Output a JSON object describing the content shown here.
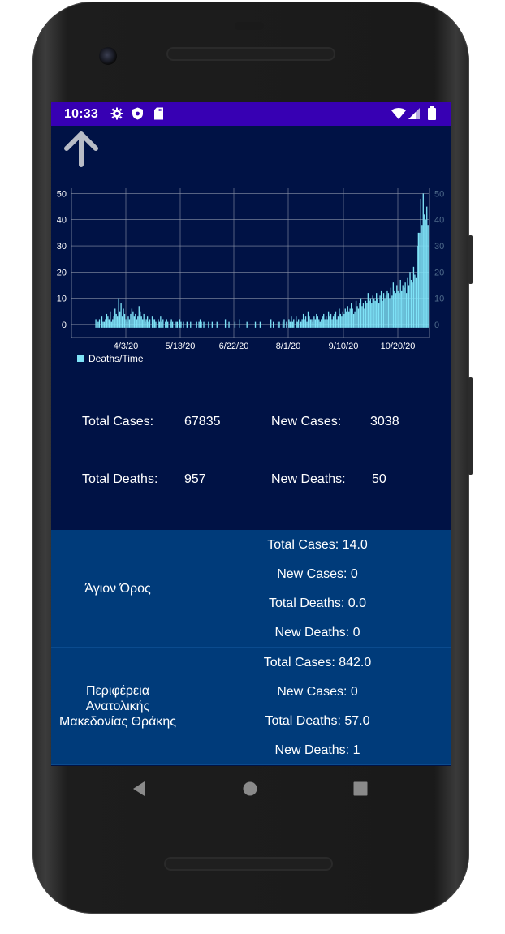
{
  "status_bar": {
    "time": "10:33"
  },
  "chart_data": {
    "type": "bar",
    "x_tick_labels": [
      "4/3/20",
      "5/13/20",
      "6/22/20",
      "8/1/20",
      "9/10/20",
      "10/20/20"
    ],
    "y_ticks": [
      0,
      10,
      20,
      30,
      40,
      50
    ],
    "ylim": [
      -5,
      52
    ],
    "legend": "Deaths/Time",
    "legend_position": "bottom-left",
    "bar_color": "#7fe3f7",
    "grid": true,
    "values": [
      0,
      0,
      0,
      2,
      1,
      1,
      2,
      0,
      3,
      1,
      1,
      2,
      4,
      3,
      2,
      5,
      1,
      2,
      3,
      6,
      4,
      3,
      10,
      5,
      8,
      3,
      6,
      4,
      2,
      1,
      3,
      2,
      4,
      6,
      5,
      3,
      4,
      2,
      3,
      7,
      5,
      3,
      2,
      4,
      1,
      2,
      3,
      1,
      2,
      0,
      3,
      2,
      2,
      1,
      0,
      2,
      1,
      3,
      1,
      2,
      0,
      1,
      2,
      1,
      0,
      1,
      2,
      1,
      0,
      0,
      1,
      1,
      0,
      2,
      1,
      0,
      1,
      0,
      0,
      1,
      0,
      0,
      1,
      0,
      0,
      0,
      0,
      1,
      0,
      1,
      2,
      1,
      0,
      1,
      0,
      0,
      0,
      1,
      0,
      0,
      1,
      0,
      0,
      0,
      1,
      0,
      0,
      0,
      0,
      0,
      0,
      2,
      0,
      0,
      1,
      0,
      0,
      0,
      0,
      1,
      0,
      0,
      0,
      2,
      0,
      0,
      0,
      0,
      0,
      1,
      0,
      0,
      0,
      0,
      0,
      0,
      1,
      0,
      0,
      0,
      1,
      0,
      0,
      0,
      0,
      0,
      0,
      0,
      0,
      2,
      0,
      1,
      0,
      0,
      0,
      1,
      1,
      0,
      0,
      1,
      2,
      0,
      1,
      0,
      2,
      1,
      3,
      1,
      2,
      0,
      3,
      1,
      2,
      0,
      1,
      2,
      4,
      2,
      3,
      1,
      5,
      3,
      2,
      2,
      1,
      3,
      2,
      4,
      3,
      2,
      1,
      2,
      3,
      4,
      2,
      3,
      2,
      5,
      3,
      4,
      2,
      3,
      4,
      5,
      2,
      3,
      6,
      4,
      3,
      5,
      4,
      6,
      5,
      7,
      5,
      6,
      8,
      6,
      4,
      5,
      9,
      7,
      6,
      8,
      10,
      7,
      8,
      6,
      9,
      8,
      12,
      9,
      10,
      8,
      11,
      10,
      9,
      12,
      10,
      8,
      11,
      13,
      9,
      12,
      10,
      11,
      13,
      12,
      10,
      14,
      11,
      16,
      13,
      12,
      15,
      13,
      12,
      17,
      13,
      15,
      14,
      16,
      12,
      18,
      15,
      20,
      17,
      16,
      22,
      19,
      18,
      30,
      35,
      35,
      48,
      38,
      50,
      42,
      40,
      45,
      38
    ]
  },
  "summary": {
    "total_cases_label": "Total Cases:",
    "total_cases_value": "67835",
    "new_cases_label": "New Cases:",
    "new_cases_value": "3038",
    "total_deaths_label": "Total Deaths:",
    "total_deaths_value": "957",
    "new_deaths_label": "New Deaths:",
    "new_deaths_value": "50"
  },
  "regions": [
    {
      "name": "Άγιον Όρος",
      "total_cases": "Total Cases: 14.0",
      "new_cases": "New Cases: 0",
      "total_deaths": "Total Deaths: 0.0",
      "new_deaths": "New Deaths: 0"
    },
    {
      "name_lines": [
        "Περιφέρεια",
        "Ανατολικής",
        "Μακεδονίας Θράκης"
      ],
      "total_cases": "Total Cases: 842.0",
      "new_cases": "New Cases: 0",
      "total_deaths": "Total Deaths: 57.0",
      "new_deaths": "New Deaths: 1"
    }
  ],
  "icons": {
    "status": [
      "gear-icon",
      "shield-icon",
      "sd-card-icon",
      "wifi-icon",
      "signal-icon",
      "battery-icon"
    ],
    "toolbar": [
      "arrow-up-icon"
    ],
    "nav": [
      "back-icon",
      "home-icon",
      "recents-icon"
    ]
  },
  "colors": {
    "status_bar": "#3700b3",
    "background": "#001245",
    "region_background": "#003b7a",
    "bar": "#7fe3f7"
  }
}
